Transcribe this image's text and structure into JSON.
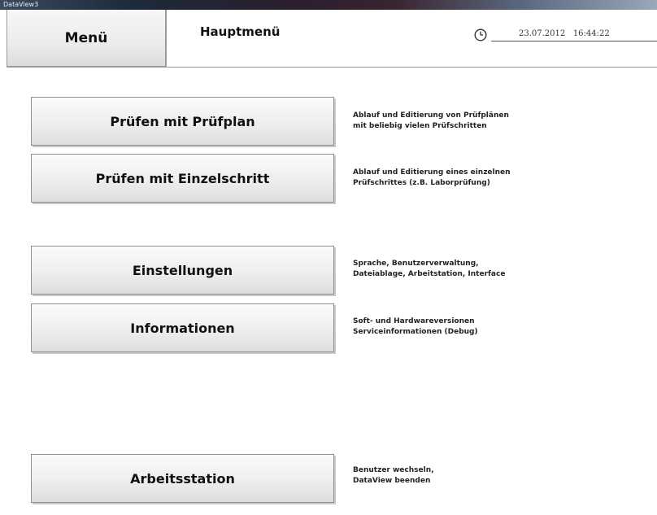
{
  "window": {
    "title": "DataView3"
  },
  "header": {
    "menu_label": "Menü",
    "page_title": "Hauptmenü",
    "date": "23.07.2012",
    "time": "16:44:22"
  },
  "items": [
    {
      "label": "Prüfen mit Prüfplan",
      "desc": [
        "Ablauf und Editierung von Prüfplänen",
        "mit beliebig vielen Prüfschritten"
      ]
    },
    {
      "label": "Prüfen mit Einzelschritt",
      "desc": [
        "Ablauf und Editierung eines einzelnen",
        "Prüfschrittes (z.B. Laborprüfung)"
      ]
    },
    {
      "label": "Einstellungen",
      "desc": [
        "Sprache, Benutzerverwaltung,",
        "Dateiablage, Arbeitstation, Interface"
      ]
    },
    {
      "label": "Informationen",
      "desc": [
        "Soft- und Hardwareversionen",
        "Serviceinformationen (Debug)"
      ]
    },
    {
      "label": "Arbeitsstation",
      "desc": [
        "Benutzer wechseln,",
        "DataView beenden"
      ]
    }
  ],
  "icons": {
    "clock": "clock-icon"
  }
}
